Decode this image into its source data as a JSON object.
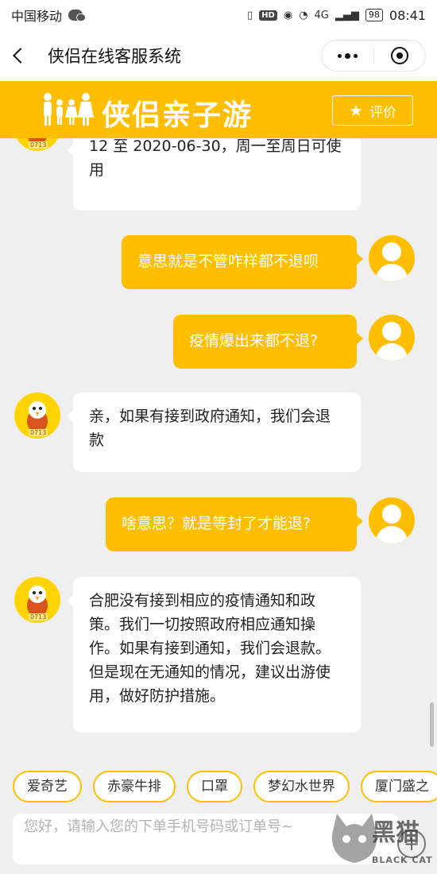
{
  "status_bar": {
    "carrier": "中国移动",
    "network": "4G",
    "hd": "HD",
    "battery": "98",
    "time": "08:41"
  },
  "nav": {
    "title": "侠侣在线客服系统"
  },
  "brand": {
    "title": "侠侣亲子游",
    "rate_label": "评价",
    "color": "#ffbf00"
  },
  "avatar": {
    "agent_tag": "0713"
  },
  "messages": [
    {
      "from": "agent",
      "text": "12 至 2020-06-30，周一至周日可使用"
    },
    {
      "from": "user",
      "text": "意思就是不管咋样都不退呗"
    },
    {
      "from": "user",
      "text": "疫情爆出来都不退?"
    },
    {
      "from": "agent",
      "text": "亲，如果有接到政府通知，我们会退款"
    },
    {
      "from": "user",
      "text": "啥意思？就是等封了才能退?"
    },
    {
      "from": "agent",
      "text": "合肥没有接到相应的疫情通知和政策。我们一切按照政府相应通知操作。如果有接到通知，我们会退款。但是现在无通知的情况，建议出游使用，做好防护措施。"
    }
  ],
  "quick_tags": [
    "爱奇艺",
    "赤豪牛排",
    "口罩",
    "梦幻水世界",
    "厦门盛之"
  ],
  "input": {
    "placeholder": "您好，请输入您的下单手机号码或订单号~",
    "plus": "+"
  },
  "watermark": {
    "text": "黑猫",
    "sub": "BLACK CAT"
  }
}
